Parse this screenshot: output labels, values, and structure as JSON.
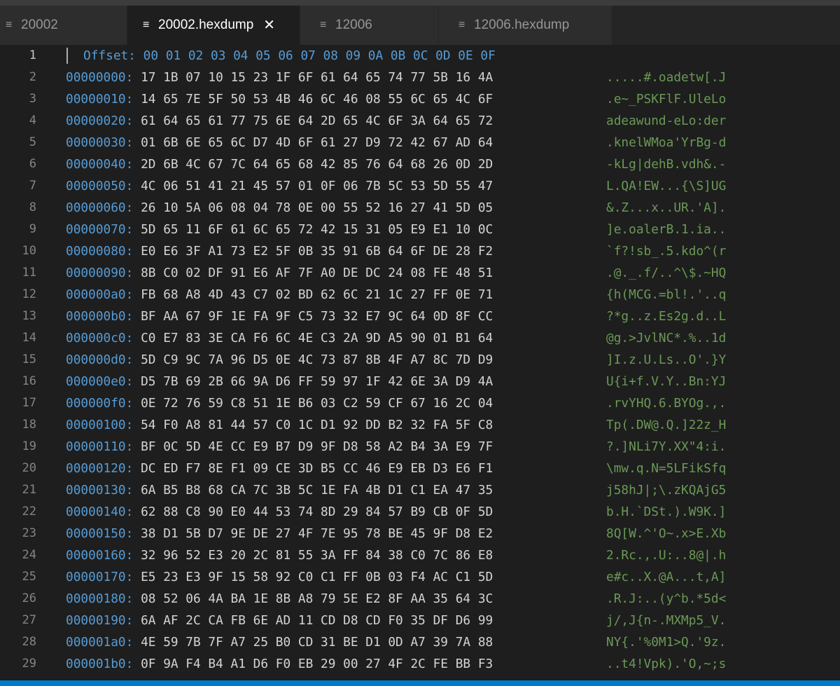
{
  "tabs": [
    {
      "label": "20002",
      "icon": "lines-icon",
      "active": false,
      "closable": false
    },
    {
      "label": "20002.hexdump",
      "icon": "lines-icon",
      "active": true,
      "closable": true
    },
    {
      "label": "12006",
      "icon": "lines-icon",
      "active": false,
      "closable": false
    },
    {
      "label": "12006.hexdump",
      "icon": "lines-icon",
      "active": false,
      "closable": false
    }
  ],
  "close_glyph": "✕",
  "icon_glyph": "≡",
  "header": {
    "line_number": "1",
    "text": "Offset: 00 01 02 03 04 05 06 07 08 09 0A 0B 0C 0D 0E 0F"
  },
  "lines": [
    {
      "n": "2",
      "offset": "00000000:",
      "hex": "17 1B 07 10 15 23 1F 6F 61 64 65 74 77 5B 16 4A",
      "ascii": ".....#.oadetw[.J"
    },
    {
      "n": "3",
      "offset": "00000010:",
      "hex": "14 65 7E 5F 50 53 4B 46 6C 46 08 55 6C 65 4C 6F",
      "ascii": ".e~_PSKFlF.UleLo"
    },
    {
      "n": "4",
      "offset": "00000020:",
      "hex": "61 64 65 61 77 75 6E 64 2D 65 4C 6F 3A 64 65 72",
      "ascii": "adeawund-eLo:der"
    },
    {
      "n": "5",
      "offset": "00000030:",
      "hex": "01 6B 6E 65 6C D7 4D 6F 61 27 D9 72 42 67 AD 64",
      "ascii": ".knelWMoa'YrBg-d"
    },
    {
      "n": "6",
      "offset": "00000040:",
      "hex": "2D 6B 4C 67 7C 64 65 68 42 85 76 64 68 26 0D 2D",
      "ascii": "-kLg|dehB.vdh&.-"
    },
    {
      "n": "7",
      "offset": "00000050:",
      "hex": "4C 06 51 41 21 45 57 01 0F 06 7B 5C 53 5D 55 47",
      "ascii": "L.QA!EW...{\\S]UG"
    },
    {
      "n": "8",
      "offset": "00000060:",
      "hex": "26 10 5A 06 08 04 78 0E 00 55 52 16 27 41 5D 05",
      "ascii": "&.Z...x..UR.'A]."
    },
    {
      "n": "9",
      "offset": "00000070:",
      "hex": "5D 65 11 6F 61 6C 65 72 42 15 31 05 E9 E1 10 0C",
      "ascii": "]e.oalerB.1.ia.."
    },
    {
      "n": "10",
      "offset": "00000080:",
      "hex": "E0 E6 3F A1 73 E2 5F 0B 35 91 6B 64 6F DE 28 F2",
      "ascii": "`f?!sb_.5.kdo^(r"
    },
    {
      "n": "11",
      "offset": "00000090:",
      "hex": "8B C0 02 DF 91 E6 AF 7F A0 DE DC 24 08 FE 48 51",
      "ascii": ".@._.f/..^\\$.~HQ"
    },
    {
      "n": "12",
      "offset": "000000a0:",
      "hex": "FB 68 A8 4D 43 C7 02 BD 62 6C 21 1C 27 FF 0E 71",
      "ascii": "{h(MCG.=bl!.'..q"
    },
    {
      "n": "13",
      "offset": "000000b0:",
      "hex": "BF AA 67 9F 1E FA 9F C5 73 32 E7 9C 64 0D 8F CC",
      "ascii": "?*g..z.Es2g.d..L"
    },
    {
      "n": "14",
      "offset": "000000c0:",
      "hex": "C0 E7 83 3E CA F6 6C 4E C3 2A 9D A5 90 01 B1 64",
      "ascii": "@g.>JvlNC*.%..1d"
    },
    {
      "n": "15",
      "offset": "000000d0:",
      "hex": "5D C9 9C 7A 96 D5 0E 4C 73 87 8B 4F A7 8C 7D D9",
      "ascii": "]I.z.U.Ls..O'.}Y"
    },
    {
      "n": "16",
      "offset": "000000e0:",
      "hex": "D5 7B 69 2B 66 9A D6 FF 59 97 1F 42 6E 3A D9 4A",
      "ascii": "U{i+f.V.Y..Bn:YJ"
    },
    {
      "n": "17",
      "offset": "000000f0:",
      "hex": "0E 72 76 59 C8 51 1E B6 03 C2 59 CF 67 16 2C 04",
      "ascii": ".rvYHQ.6.BYOg.,."
    },
    {
      "n": "18",
      "offset": "00000100:",
      "hex": "54 F0 A8 81 44 57 C0 1C D1 92 DD B2 32 FA 5F C8",
      "ascii": "Tp(.DW@.Q.]22z_H"
    },
    {
      "n": "19",
      "offset": "00000110:",
      "hex": "BF 0C 5D 4E CC E9 B7 D9 9F D8 58 A2 B4 3A E9 7F",
      "ascii": "?.]NLi7Y.XX\"4:i."
    },
    {
      "n": "20",
      "offset": "00000120:",
      "hex": "DC ED F7 8E F1 09 CE 3D B5 CC 46 E9 EB D3 E6 F1",
      "ascii": "\\mw.q.N=5LFikSfq"
    },
    {
      "n": "21",
      "offset": "00000130:",
      "hex": "6A B5 B8 68 CA 7C 3B 5C 1E FA 4B D1 C1 EA 47 35",
      "ascii": "j58hJ|;\\.zKQAjG5"
    },
    {
      "n": "22",
      "offset": "00000140:",
      "hex": "62 88 C8 90 E0 44 53 74 8D 29 84 57 B9 CB 0F 5D",
      "ascii": "b.H.`DSt.).W9K.]"
    },
    {
      "n": "23",
      "offset": "00000150:",
      "hex": "38 D1 5B D7 9E DE 27 4F 7E 95 78 BE 45 9F D8 E2",
      "ascii": "8Q[W.^'O~.x>E.Xb"
    },
    {
      "n": "24",
      "offset": "00000160:",
      "hex": "32 96 52 E3 20 2C 81 55 3A FF 84 38 C0 7C 86 E8",
      "ascii": "2.Rc.,.U:..8@|.h"
    },
    {
      "n": "25",
      "offset": "00000170:",
      "hex": "E5 23 E3 9F 15 58 92 C0 C1 FF 0B 03 F4 AC C1 5D",
      "ascii": "e#c..X.@A...t,A]"
    },
    {
      "n": "26",
      "offset": "00000180:",
      "hex": "08 52 06 4A BA 1E 8B A8 79 5E E2 8F AA 35 64 3C",
      "ascii": ".R.J:..(y^b.*5d<"
    },
    {
      "n": "27",
      "offset": "00000190:",
      "hex": "6A AF 2C CA FB 6E AD 11 CD D8 CD F0 35 DF D6 99",
      "ascii": "j/,J{n-.MXMp5_V."
    },
    {
      "n": "28",
      "offset": "000001a0:",
      "hex": "4E 59 7B 7F A7 25 B0 CD 31 BE D1 0D A7 39 7A 88",
      "ascii": "NY{.'%0M1>Q.'9z."
    },
    {
      "n": "29",
      "offset": "000001b0:",
      "hex": "0F 9A F4 B4 A1 D6 F0 EB 29 00 27 4F 2C FE BB F3",
      "ascii": "..t4!Vpk).'O,~;s"
    }
  ]
}
